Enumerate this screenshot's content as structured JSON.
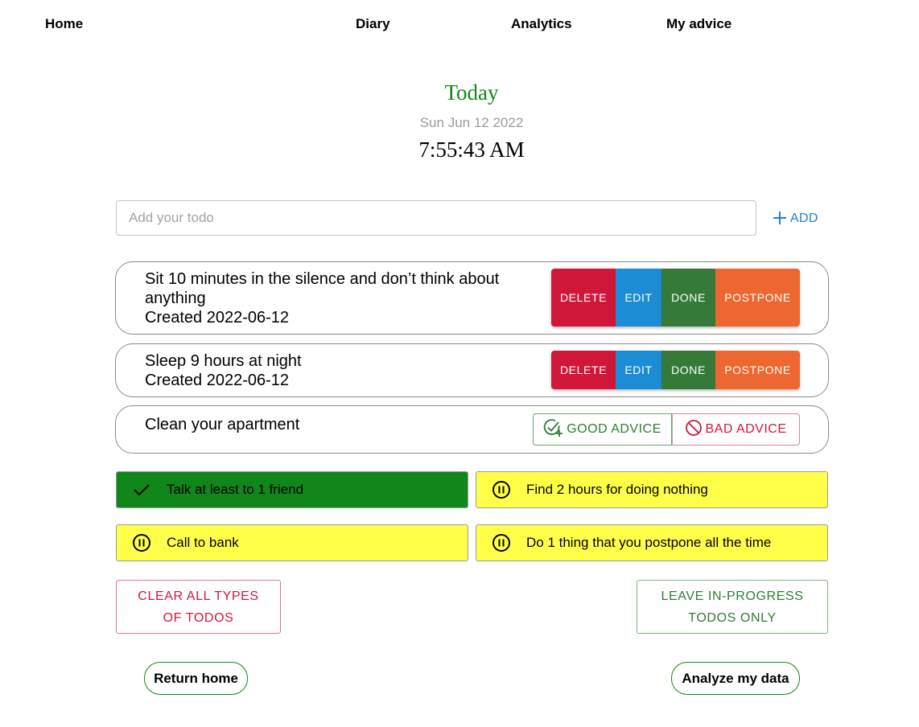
{
  "nav": {
    "items": [
      {
        "label": "Home"
      },
      {
        "label": "Diary"
      },
      {
        "label": "Analytics"
      },
      {
        "label": "My advice"
      }
    ]
  },
  "header": {
    "title": "Today",
    "date": "Sun Jun 12 2022",
    "time": "7:55:43 AM"
  },
  "add_todo": {
    "placeholder": "Add your todo",
    "value": "",
    "add_label": "ADD",
    "add_icon": "plus-icon"
  },
  "todos": [
    {
      "text": "Sit 10 minutes in the silence and don’t think about anything",
      "created": "Created 2022-06-12",
      "actions": {
        "delete": "DELETE",
        "edit": "EDIT",
        "done": "DONE",
        "postpone": "POSTPONE"
      }
    },
    {
      "text": "Sleep 9 hours at night",
      "created": "Created 2022-06-12",
      "actions": {
        "delete": "DELETE",
        "edit": "EDIT",
        "done": "DONE",
        "postpone": "POSTPONE"
      }
    },
    {
      "text": "Clean your apartment",
      "advice": {
        "good": "GOOD ADVICE",
        "bad": "BAD ADVICE",
        "good_icon": "check-plus-icon",
        "bad_icon": "block-icon"
      }
    }
  ],
  "status_todos": [
    {
      "label": "Talk at least to 1 friend",
      "status": "done",
      "icon": "check-icon"
    },
    {
      "label": "Find 2 hours for doing nothing",
      "status": "in-progress",
      "icon": "pause-circle-icon"
    },
    {
      "label": "Call to bank",
      "status": "in-progress",
      "icon": "pause-circle-icon"
    },
    {
      "label": "Do 1 thing that you postpone all the time",
      "status": "in-progress",
      "icon": "pause-circle-icon"
    }
  ],
  "bulk_actions": {
    "clear_line1": "CLEAR ALL TYPES",
    "clear_line2": "OF TODOS",
    "leave_line1": "LEAVE IN-PROGRESS",
    "leave_line2": "TODOS ONLY"
  },
  "footer": {
    "return_home": "Return home",
    "analyze": "Analyze my data"
  },
  "colors": {
    "accent_green": "#128712",
    "delete_red": "#d0173a",
    "edit_blue": "#1c8cd4",
    "done_green": "#357a38",
    "postpone_orange": "#ed6830",
    "done_tile": "#11861b",
    "progress_tile": "#ffff4a",
    "link_blue": "#1e7fd6"
  }
}
